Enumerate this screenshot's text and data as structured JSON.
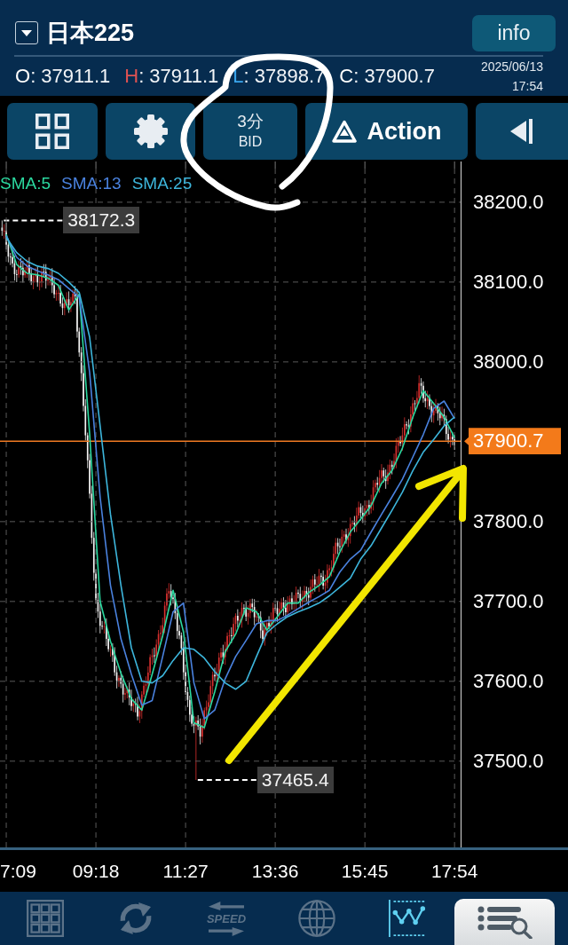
{
  "header": {
    "symbol": "日本225",
    "info_button": "info",
    "ohlc": [
      {
        "label": "O",
        "reading": ": 37911.1",
        "color": "#ffffff"
      },
      {
        "label": "H",
        "reading": ": 37911.1",
        "color": "#e05252"
      },
      {
        "label": "L",
        "reading": ": 37898.7",
        "color": "#3aa6ee"
      },
      {
        "label": "C",
        "reading": ": 37900.7",
        "color": "#ffffff"
      }
    ],
    "date": "2025/06/13",
    "time": "17:54"
  },
  "toolbar": {
    "timeframe": "3分",
    "price_type": "BID",
    "action_button": "Action"
  },
  "chart": {
    "chart_data": {
      "type": "line",
      "x": [
        429,
        444,
        459,
        474,
        489,
        504,
        519,
        534,
        549,
        564,
        579,
        594,
        609,
        624,
        639,
        654,
        669,
        684,
        699,
        714,
        729,
        744,
        759,
        774,
        789,
        804,
        819,
        834,
        849,
        864,
        879,
        894,
        909,
        924,
        939,
        954,
        969,
        984,
        999,
        1014,
        1029,
        1044,
        1059,
        1074
      ],
      "series": [
        {
          "name": "SMA:5",
          "color": "#2bd9a0",
          "values": [
            38160,
            38122,
            38111,
            38109,
            38105,
            38096,
            38065,
            38085,
            37910,
            37700,
            37650,
            37610,
            37578,
            37564,
            37609,
            37657,
            37714,
            37662,
            37548,
            37542,
            37587,
            37637,
            37659,
            37692,
            37687,
            37664,
            37681,
            37698,
            37698,
            37711,
            37720,
            37731,
            37762,
            37787,
            37803,
            37820,
            37848,
            37864,
            37892,
            37931,
            37964,
            37948,
            37931,
            37905
          ]
        },
        {
          "name": "SMA:13",
          "color": "#4a82df",
          "values": [
            38158,
            38131,
            38120,
            38114,
            38109,
            38103,
            38092,
            38081,
            37987,
            37831,
            37720,
            37653,
            37609,
            37570,
            37576,
            37631,
            37687,
            37698,
            37598,
            37553,
            37564,
            37603,
            37631,
            37651,
            37672,
            37676,
            37676,
            37683,
            37691,
            37699,
            37706,
            37714,
            37737,
            37753,
            37764,
            37787,
            37809,
            37831,
            37853,
            37881,
            37909,
            37942,
            37951,
            37929
          ]
        },
        {
          "name": "SMA:25",
          "color": "#3db6dc",
          "values": [
            38156,
            38137,
            38126,
            38120,
            38117,
            38111,
            38100,
            38087,
            38031,
            37920,
            37809,
            37720,
            37642,
            37600,
            37598,
            37607,
            37626,
            37642,
            37640,
            37629,
            37612,
            37598,
            37590,
            37600,
            37631,
            37661,
            37672,
            37681,
            37687,
            37692,
            37698,
            37707,
            37718,
            37729,
            37753,
            37770,
            37792,
            37814,
            37837,
            37864,
            37887,
            37903,
            37920,
            37931
          ]
        }
      ],
      "xlim": [
        420,
        1084
      ],
      "ylim": [
        37392,
        38251
      ],
      "grid": true,
      "xticks": [
        {
          "value": 429,
          "label": "7:09"
        },
        {
          "value": 558,
          "label": "09:18"
        },
        {
          "value": 687,
          "label": "11:27"
        },
        {
          "value": 816,
          "label": "13:36"
        },
        {
          "value": 945,
          "label": "15:45"
        },
        {
          "value": 1074,
          "label": "17:54"
        }
      ],
      "yticks": [
        {
          "value": 38200,
          "label": "38200.0"
        },
        {
          "value": 38100,
          "label": "38100.0"
        },
        {
          "value": 38000,
          "label": "38000.0"
        },
        {
          "value": 37800,
          "label": "37800.0"
        },
        {
          "value": 37700,
          "label": "37700.0"
        },
        {
          "value": 37600,
          "label": "37600.0"
        },
        {
          "value": 37500,
          "label": "37500.0"
        }
      ],
      "annotations": [
        "38172.3",
        "37465.4"
      ],
      "ref_lines": [
        {
          "axis": "y",
          "value": 37900.7,
          "label": "37900.7"
        }
      ]
    }
  },
  "bottom_nav": {
    "items": [
      {
        "selected": false
      },
      {
        "selected": false
      },
      {
        "label": "SPEED",
        "selected": false
      },
      {
        "selected": false
      },
      {
        "selected": true
      }
    ]
  }
}
